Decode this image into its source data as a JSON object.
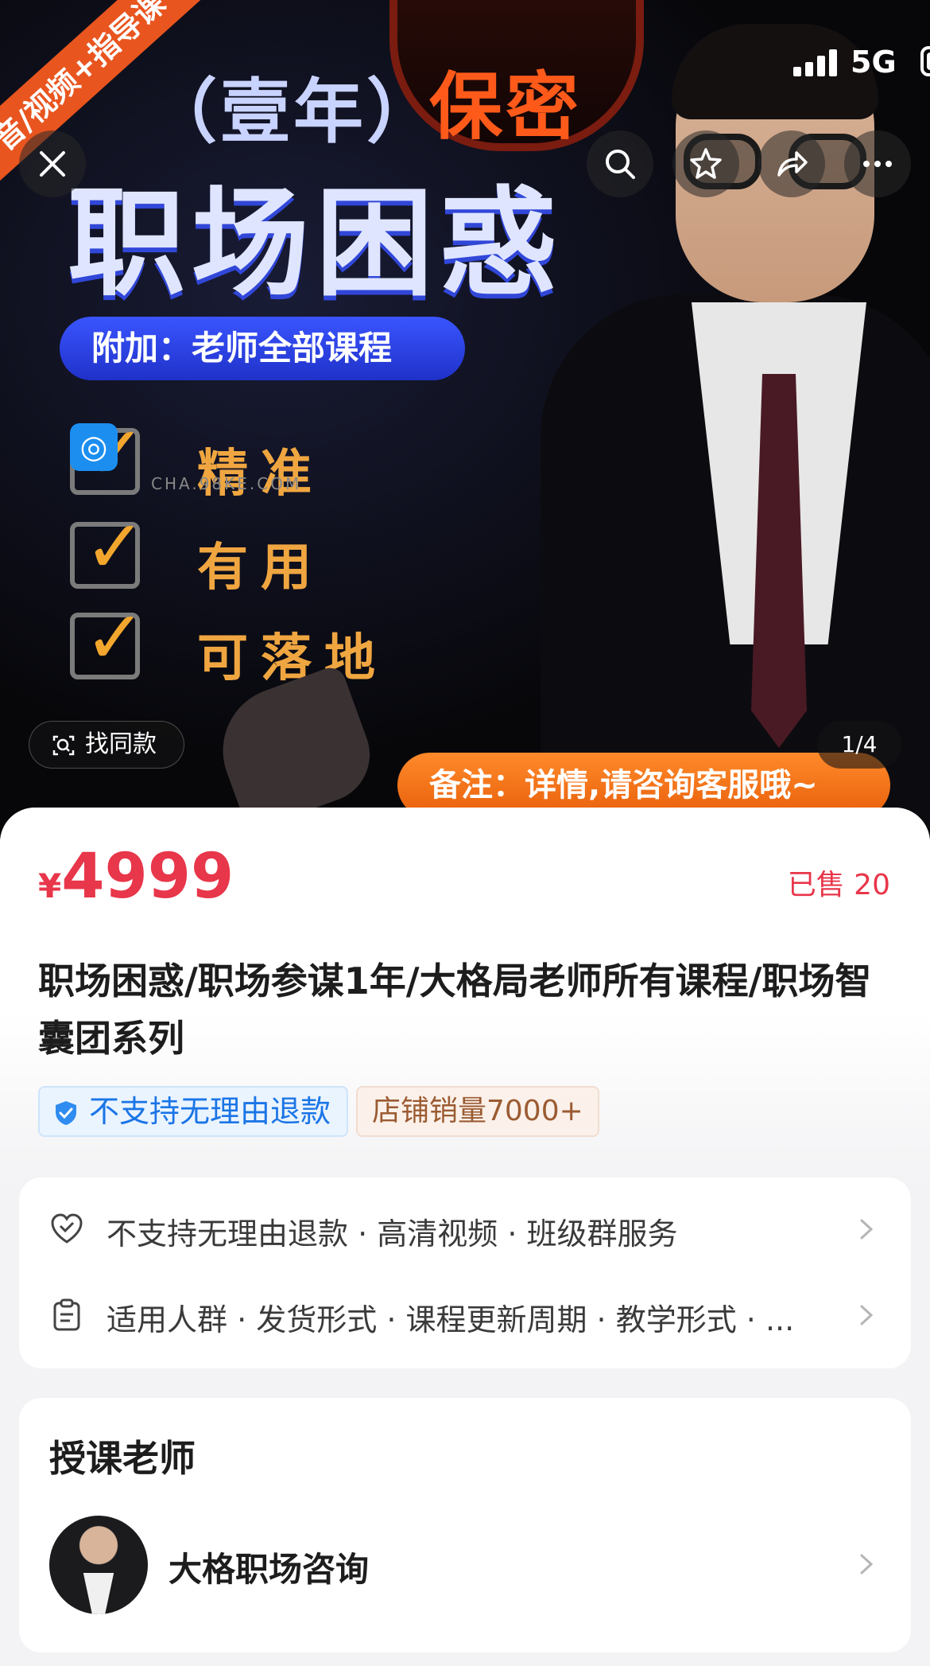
{
  "status_bar": {
    "network": "5G"
  },
  "hero": {
    "ribbon": "音/视频+指导课",
    "year": "（壹年）",
    "secret": "保密",
    "main_title": "职场困惑",
    "addon": "附加：老师全部课程",
    "checks": [
      "精准",
      "有用",
      "可落地"
    ],
    "watermark": "CHA.98KE.COM",
    "note": "备注：详情,请咨询客服哦~",
    "find_same": "找同款",
    "pager": "1/4"
  },
  "product": {
    "currency": "¥",
    "price": "4999",
    "sold": "已售 20",
    "title": "职场困惑/职场参谋1年/大格局老师所有课程/职场智囊团系列",
    "tags": [
      "不支持无理由退款",
      "店铺销量7000+"
    ]
  },
  "service_rows": [
    {
      "icon": "heart-shield-icon",
      "text": "不支持无理由退款 · 高清视频 · 班级群服务"
    },
    {
      "icon": "clipboard-icon",
      "text": "适用人群 · 发货形式 · 课程更新周期 · 教学形式 · ..."
    }
  ],
  "teacher_section": {
    "title": "授课老师",
    "name": "大格职场咨询"
  },
  "colors": {
    "price": "#e8364a",
    "tag_blue": "#1b75e6",
    "tag_brown": "#9b5b32"
  }
}
